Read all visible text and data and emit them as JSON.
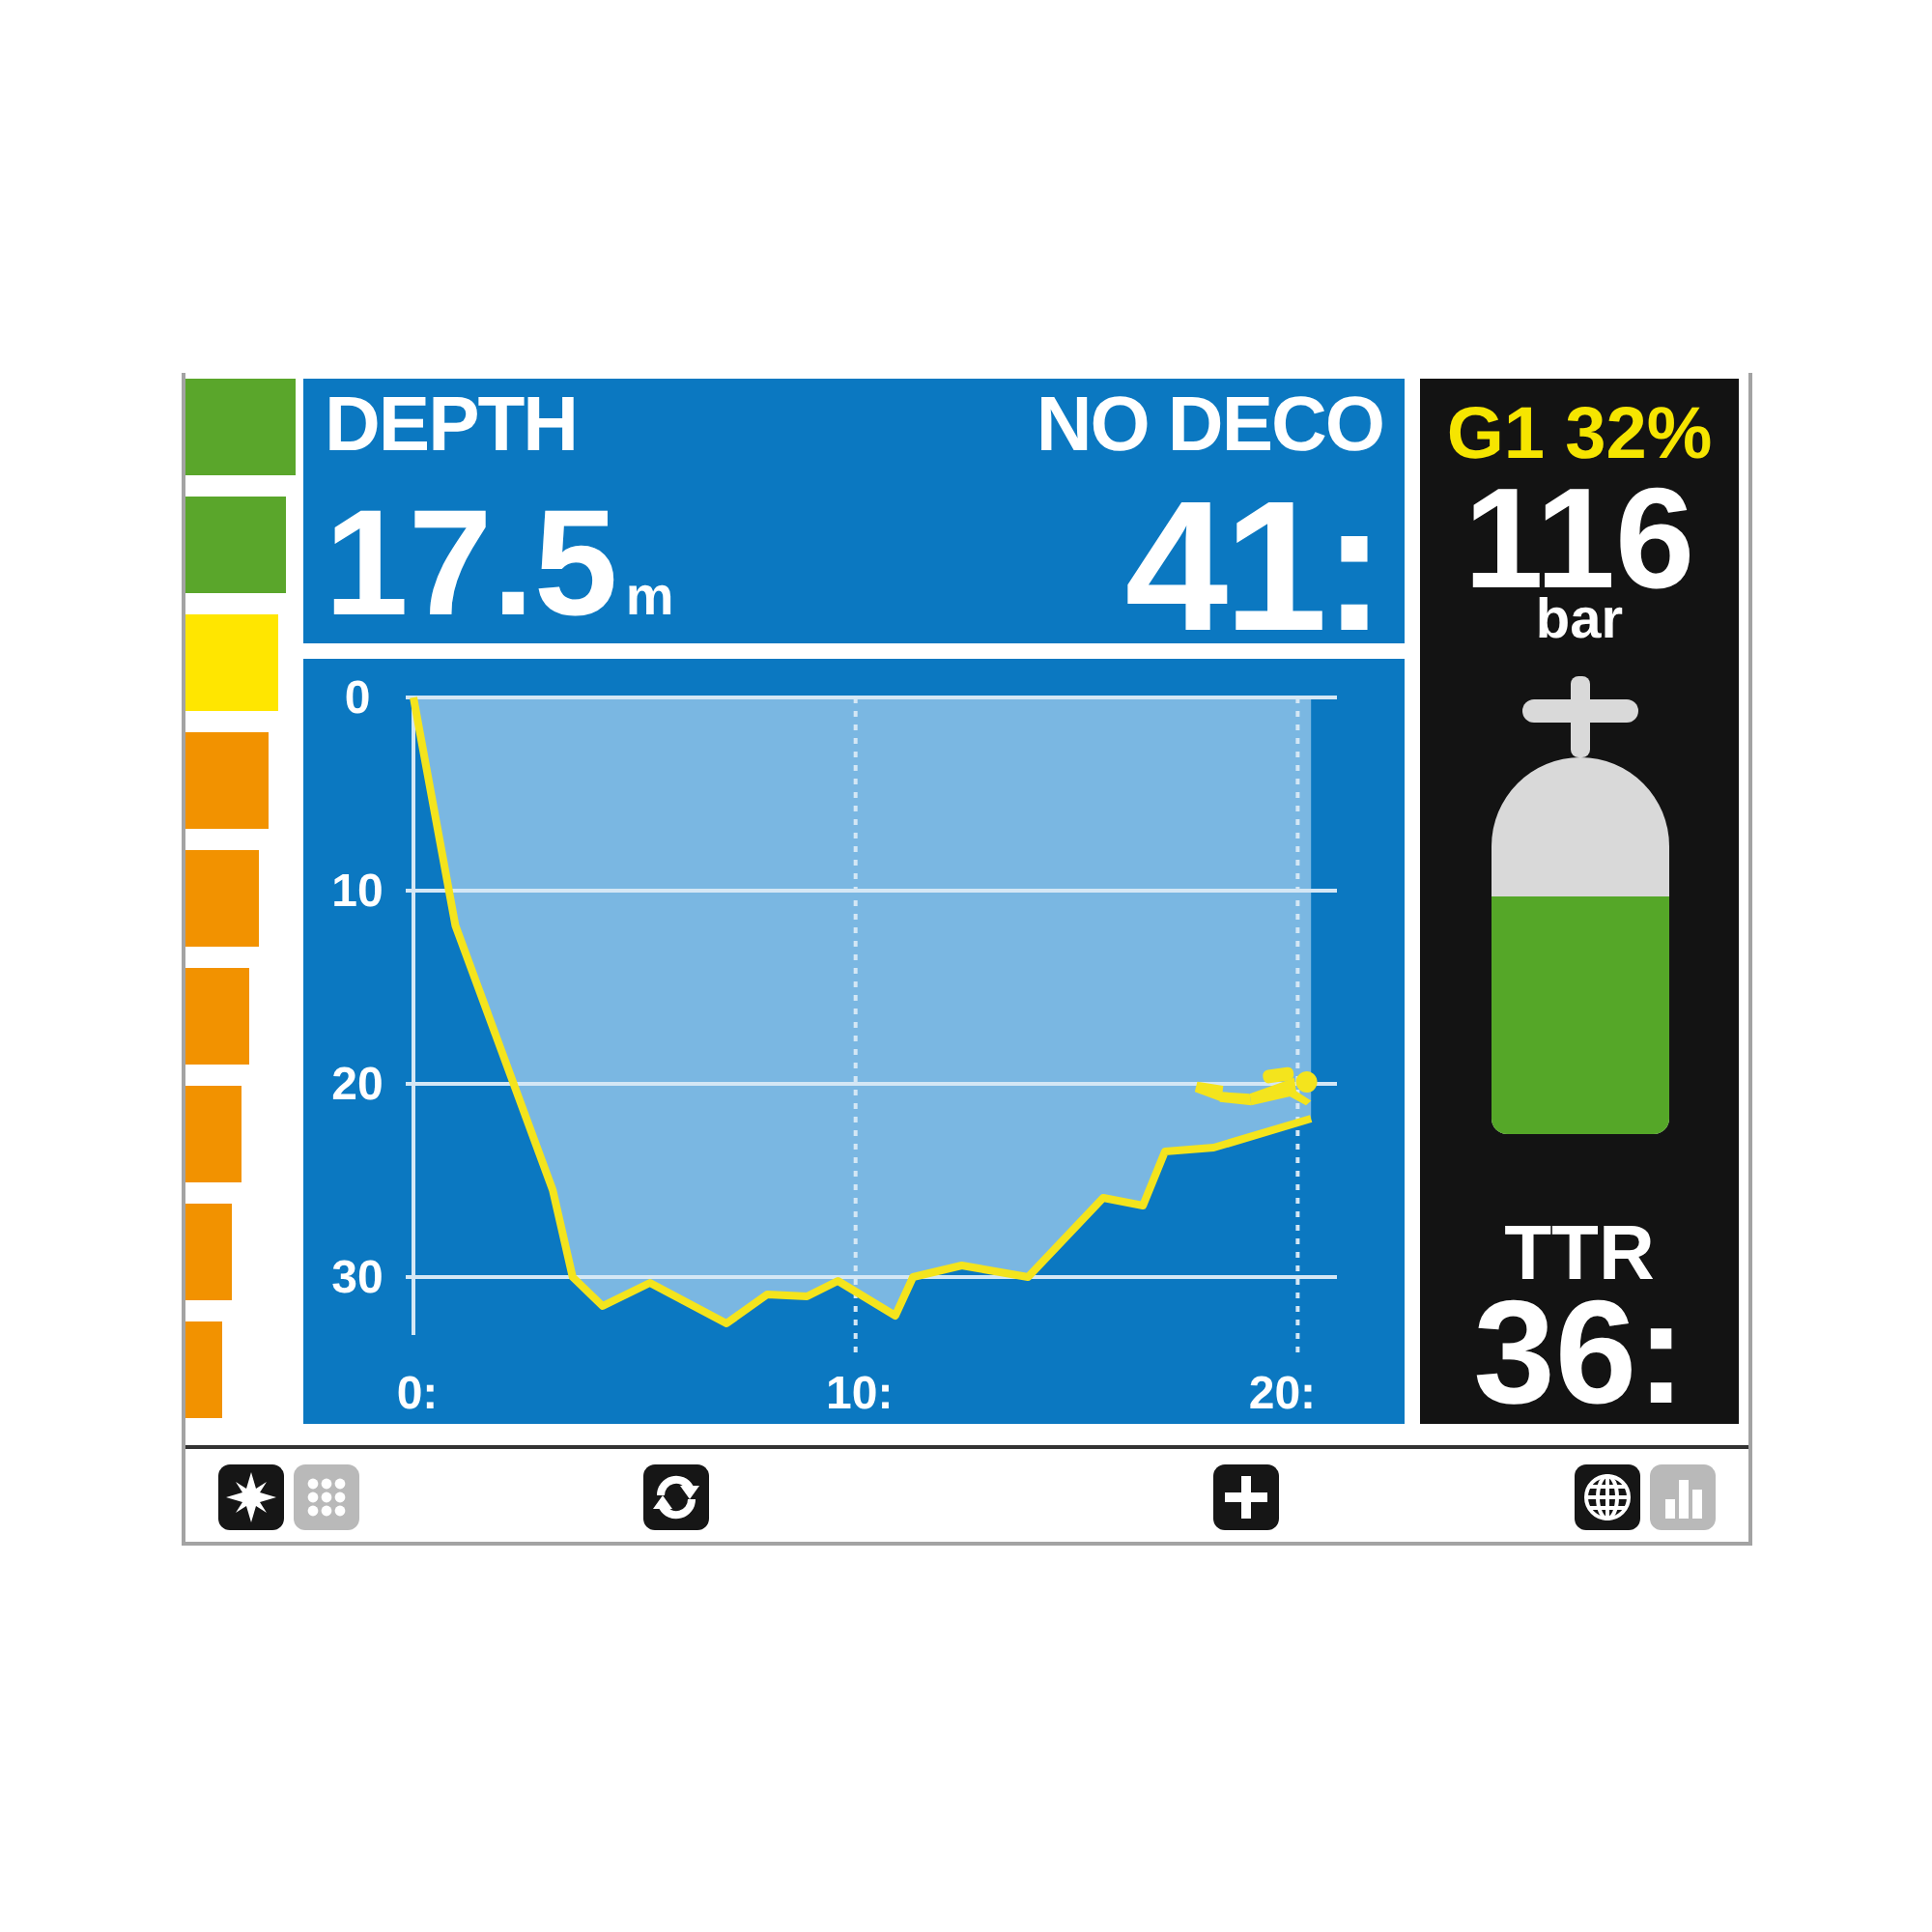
{
  "side_bar_graph": {
    "segments": [
      {
        "color": "#5aa62b"
      },
      {
        "color": "#5aa62b"
      },
      {
        "color": "#ffe600"
      },
      {
        "color": "#f29200"
      },
      {
        "color": "#f29200"
      },
      {
        "color": "#f29200"
      },
      {
        "color": "#f29200"
      },
      {
        "color": "#f29200"
      },
      {
        "color": "#f29200"
      }
    ]
  },
  "header": {
    "depth_label": "DEPTH",
    "depth_value": "17.5",
    "depth_unit": "m",
    "ndl_label": "NO DECO",
    "ndl_value": "41:"
  },
  "profile": {
    "chart_data": {
      "type": "area",
      "x": [
        0,
        0.95,
        3.15,
        3.6,
        4.28,
        5.35,
        7.08,
        8.0,
        8.9,
        9.6,
        10.9,
        11.3,
        12.4,
        13.9,
        15.6,
        16.5,
        17.0,
        18.1,
        20.3
      ],
      "values": [
        0,
        11.8,
        25.5,
        30,
        31.5,
        30.3,
        32.4,
        30.9,
        31.0,
        30.2,
        32.0,
        30,
        29.4,
        30,
        25.9,
        26.3,
        23.5,
        23.3,
        21.8
      ],
      "xlim": [
        0,
        20.8
      ],
      "ylim": [
        33,
        0
      ],
      "xticks": [
        {
          "value": 0,
          "label": "0:"
        },
        {
          "value": 10,
          "label": "10:"
        },
        {
          "value": 20,
          "label": "20:"
        }
      ],
      "yticks": [
        0,
        10,
        20,
        30
      ],
      "grid": true
    }
  },
  "gas": {
    "mix": "G1 32%",
    "pressure": "116",
    "pressure_unit": "bar",
    "tank": {
      "level": 0.63
    },
    "ttr_label": "TTR",
    "ttr_value": "36:"
  },
  "toolbar": {
    "groups": [
      {
        "icons": [
          {
            "kind": "compass",
            "active": true
          },
          {
            "kind": "grid",
            "active": false
          }
        ]
      },
      {
        "icons": [
          {
            "kind": "cycle",
            "active": true
          }
        ]
      },
      {
        "icons": [
          {
            "kind": "plus",
            "active": true
          }
        ]
      },
      {
        "icons": [
          {
            "kind": "globe",
            "active": true
          },
          {
            "kind": "bars",
            "active": false
          }
        ]
      }
    ]
  }
}
